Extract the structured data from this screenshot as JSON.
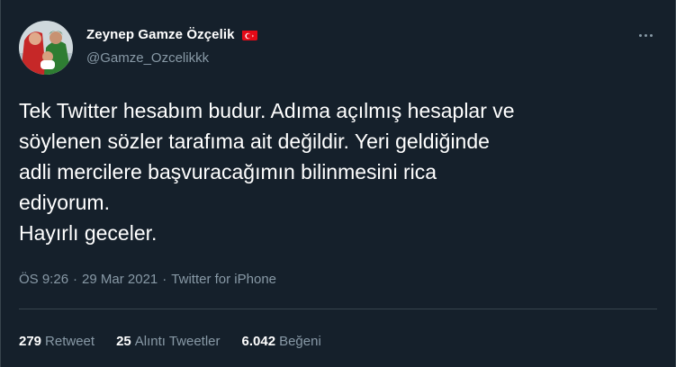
{
  "author": {
    "display_name": "Zeynep Gamze Özçelik",
    "handle": "@Gamze_Ozcelikkk",
    "flag_icon": "turkey-flag-icon",
    "verified": false
  },
  "tweet": {
    "lines": [
      "Tek Twitter hesabım budur. Adıma açılmış hesaplar ve",
      "söylenen sözler tarafıma ait değildir. Yeri geldiğinde",
      "adli mercilere başvuracağımın bilinmesini rica",
      "ediyorum.",
      "Hayırlı geceler."
    ]
  },
  "meta": {
    "time": "ÖS 9:26",
    "separator": "·",
    "date": "29 Mar 2021",
    "source": "Twitter for iPhone"
  },
  "stats": {
    "retweets": {
      "count": "279",
      "label": "Retweet"
    },
    "quotes": {
      "count": "25",
      "label": "Alıntı Tweetler"
    },
    "likes": {
      "count": "6.042",
      "label": "Beğeni"
    }
  },
  "colors": {
    "background": "#15202b",
    "text_primary": "#ffffff",
    "text_secondary": "#8899a6",
    "divider": "#38444d",
    "flag_red": "#e30a17"
  },
  "icons": {
    "more": "more-options-icon"
  }
}
